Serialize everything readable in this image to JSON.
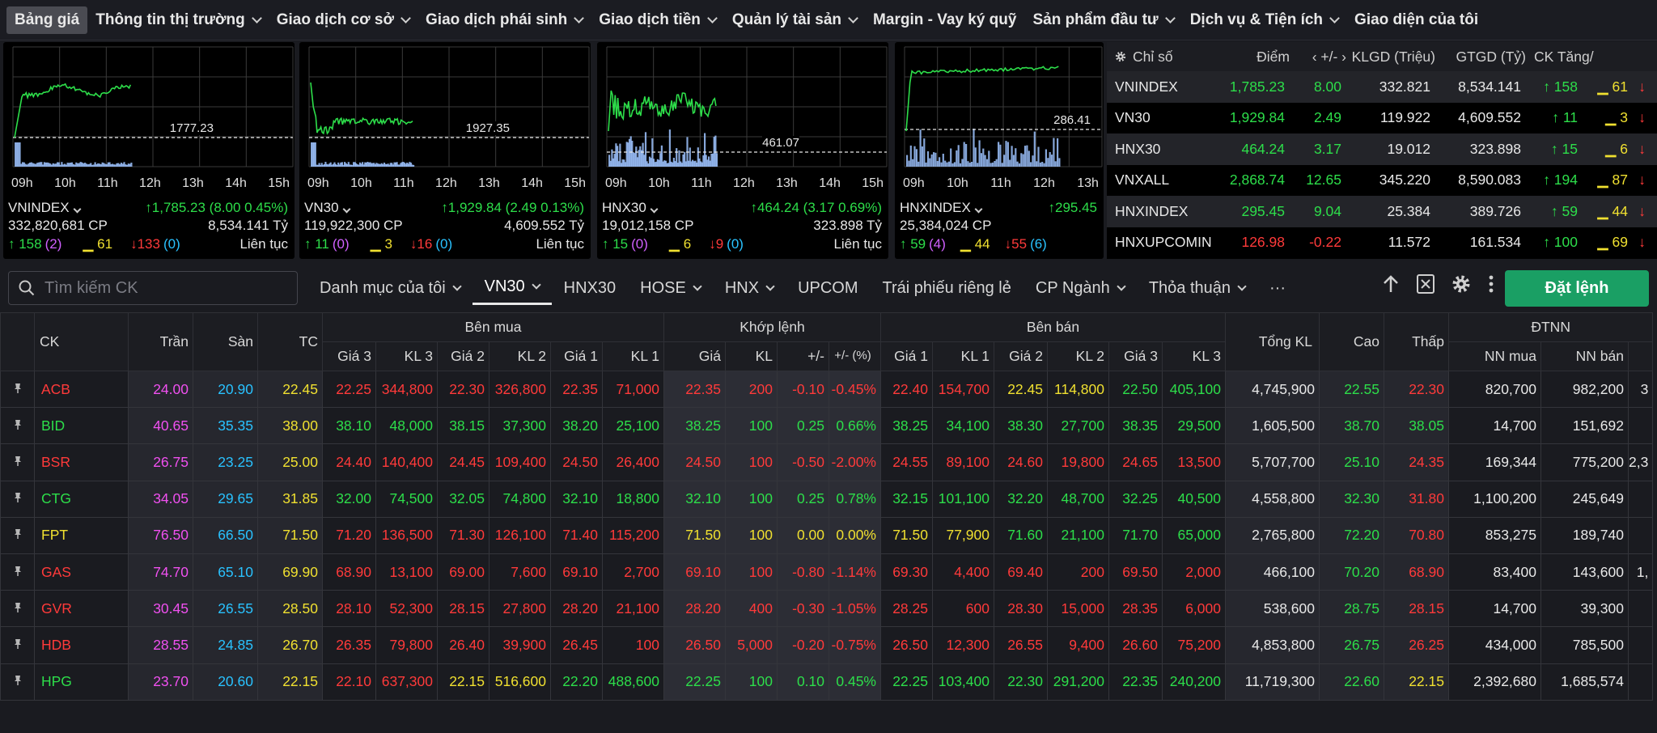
{
  "nav": [
    "Bảng giá",
    "Thông tin thị trường",
    "Giao dịch cơ sở",
    "Giao dịch phái sinh",
    "Giao dịch tiền",
    "Quản lý tài sản",
    "Margin - Vay ký quỹ",
    "Sản phẩm đầu tư",
    "Dịch vụ & Tiện ích",
    "Giao diện của tôi"
  ],
  "nav_dropdown": [
    false,
    true,
    true,
    true,
    true,
    true,
    false,
    true,
    true,
    false
  ],
  "index_cards": [
    {
      "name": "VNINDEX",
      "ref_label": "1777.23",
      "change": "↑1,785.23 (8.00 0.45%)",
      "volume": "332,820,681 CP",
      "value": "8,534.141 Tỷ",
      "up": "↑ 158",
      "up_ceil": "(2)",
      "flat": "▁ 61",
      "down": "↓133",
      "down_floor": "(0)",
      "status": "Liên tục",
      "times": [
        "09h",
        "10h",
        "11h",
        "12h",
        "13h",
        "14h",
        "15h"
      ]
    },
    {
      "name": "VN30",
      "ref_label": "1927.35",
      "change": "↑1,929.84 (2.49 0.13%)",
      "volume": "119,922,300 CP",
      "value": "4,609.552 Tỷ",
      "up": "↑ 11",
      "up_ceil": "(0)",
      "flat": "▁ 3",
      "down": "↓16",
      "down_floor": "(0)",
      "status": "Liên tục",
      "times": [
        "09h",
        "10h",
        "11h",
        "12h",
        "13h",
        "14h",
        "15h"
      ]
    },
    {
      "name": "HNX30",
      "ref_label": "461.07",
      "change": "↑464.24 (3.17 0.69%)",
      "volume": "19,012,158 CP",
      "value": "323.898 Tỷ",
      "up": "↑ 15",
      "up_ceil": "(0)",
      "flat": "▁ 6",
      "down": "↓9",
      "down_floor": "(0)",
      "status": "Liên tục",
      "times": [
        "09h",
        "10h",
        "11h",
        "12h",
        "13h",
        "14h",
        "15h"
      ]
    },
    {
      "name": "HNXINDEX",
      "ref_label": "286.41",
      "change": "↑295.45",
      "volume": "25,384,024 CP",
      "value": "",
      "up": "↑ 59",
      "up_ceil": "(4)",
      "flat": "▁ 44",
      "down": "↓55",
      "down_floor": "(6)",
      "status": "",
      "times": [
        "09h",
        "10h",
        "11h",
        "12h",
        "13h"
      ]
    }
  ],
  "index_table": {
    "headers": [
      "Chỉ số",
      "Điểm",
      "‹ +/- ›",
      "KLGD (Triệu)",
      "GTGD (Tỷ)",
      "CK Tăng/"
    ],
    "rows": [
      [
        "VNINDEX",
        "1,785.23",
        "8.00",
        "332.821",
        "8,534.141",
        "↑ 158",
        "▁ 61",
        "↓"
      ],
      [
        "VN30",
        "1,929.84",
        "2.49",
        "119.922",
        "4,609.552",
        "↑ 11",
        "▁ 3",
        "↓"
      ],
      [
        "HNX30",
        "464.24",
        "3.17",
        "19.012",
        "323.898",
        "↑ 15",
        "▁ 6",
        "↓"
      ],
      [
        "VNXALL",
        "2,868.74",
        "12.65",
        "345.220",
        "8,590.083",
        "↑ 194",
        "▁ 87",
        "↓"
      ],
      [
        "HNXINDEX",
        "295.45",
        "9.04",
        "25.384",
        "389.726",
        "↑ 59",
        "▁ 44",
        "↓"
      ],
      [
        "HNXUPCOMINDEX",
        "126.98",
        "-0.22",
        "11.572",
        "161.534",
        "↑ 100",
        "▁ 69",
        "↓"
      ]
    ],
    "row_colors": [
      "up",
      "up",
      "up",
      "up",
      "up",
      "dn"
    ]
  },
  "search": {
    "placeholder": "Tìm kiếm CK"
  },
  "tabs": [
    {
      "label": "Danh mục của tôi",
      "dd": true
    },
    {
      "label": "VN30",
      "dd": true,
      "active": true
    },
    {
      "label": "HNX30",
      "dd": false
    },
    {
      "label": "HOSE",
      "dd": true
    },
    {
      "label": "HNX",
      "dd": true
    },
    {
      "label": "UPCOM",
      "dd": false
    },
    {
      "label": "Trái phiếu riêng lẻ",
      "dd": false
    },
    {
      "label": "CP Ngành",
      "dd": true
    },
    {
      "label": "Thỏa thuận",
      "dd": true
    },
    {
      "label": "···",
      "dd": false
    }
  ],
  "order_button": "Đặt lệnh",
  "board": {
    "group_headers": {
      "buy": "Bên mua",
      "match": "Khớp lệnh",
      "sell": "Bên bán",
      "foreign": "ĐTNN"
    },
    "headers": [
      "CK",
      "Trần",
      "Sàn",
      "TC",
      "Giá 3",
      "KL 3",
      "Giá 2",
      "KL 2",
      "Giá 1",
      "KL 1",
      "Giá",
      "KL",
      "+/-",
      "+/- (%)",
      "Giá 1",
      "KL 1",
      "Giá 2",
      "KL 2",
      "Giá 3",
      "KL 3",
      "Tổng KL",
      "Cao",
      "Thấp",
      "NN mua",
      "NN bán"
    ],
    "rows": [
      {
        "s": "ACB",
        "c": [
          "24.00",
          "20.90",
          "22.45",
          "22.25",
          "344,800",
          "22.30",
          "326,800",
          "22.35",
          "71,000",
          "22.35",
          "200",
          "-0.10",
          "-0.45%",
          "22.40",
          "154,700",
          "22.45",
          "114,800",
          "22.50",
          "405,100",
          "4,745,900",
          "22.55",
          "22.30",
          "820,700",
          "982,200",
          "3"
        ],
        "k": "dn",
        "bk": [
          "dn",
          "dn",
          "dn"
        ],
        "sk": [
          "dn",
          "ref",
          "up"
        ],
        "hk": "up",
        "lk": "dn"
      },
      {
        "s": "BID",
        "c": [
          "40.65",
          "35.35",
          "38.00",
          "38.10",
          "48,000",
          "38.15",
          "37,300",
          "38.20",
          "25,100",
          "38.25",
          "100",
          "0.25",
          "0.66%",
          "38.25",
          "34,100",
          "38.30",
          "27,700",
          "38.35",
          "29,500",
          "1,605,500",
          "38.70",
          "38.05",
          "14,700",
          "151,692",
          ""
        ],
        "k": "up",
        "bk": [
          "up",
          "up",
          "up"
        ],
        "sk": [
          "up",
          "up",
          "up"
        ],
        "hk": "up",
        "lk": "up"
      },
      {
        "s": "BSR",
        "c": [
          "26.75",
          "23.25",
          "25.00",
          "24.40",
          "140,400",
          "24.45",
          "109,400",
          "24.50",
          "26,400",
          "24.50",
          "100",
          "-0.50",
          "-2.00%",
          "24.55",
          "89,100",
          "24.60",
          "19,800",
          "24.65",
          "13,500",
          "5,707,700",
          "25.10",
          "24.35",
          "169,344",
          "775,200",
          "2,3"
        ],
        "k": "dn",
        "bk": [
          "dn",
          "dn",
          "dn"
        ],
        "sk": [
          "dn",
          "dn",
          "dn"
        ],
        "hk": "up",
        "lk": "dn"
      },
      {
        "s": "CTG",
        "c": [
          "34.05",
          "29.65",
          "31.85",
          "32.00",
          "74,500",
          "32.05",
          "74,800",
          "32.10",
          "18,800",
          "32.10",
          "100",
          "0.25",
          "0.78%",
          "32.15",
          "101,100",
          "32.20",
          "48,700",
          "32.25",
          "40,500",
          "4,558,800",
          "32.30",
          "31.80",
          "1,100,200",
          "245,649",
          ""
        ],
        "k": "up",
        "bk": [
          "up",
          "up",
          "up"
        ],
        "sk": [
          "up",
          "up",
          "up"
        ],
        "hk": "up",
        "lk": "dn"
      },
      {
        "s": "FPT",
        "c": [
          "76.50",
          "66.50",
          "71.50",
          "71.20",
          "136,500",
          "71.30",
          "126,100",
          "71.40",
          "115,200",
          "71.50",
          "100",
          "0.00",
          "0.00%",
          "71.50",
          "77,900",
          "71.60",
          "21,100",
          "71.70",
          "65,000",
          "2,765,800",
          "72.20",
          "70.80",
          "853,275",
          "189,740",
          ""
        ],
        "k": "ref",
        "bk": [
          "dn",
          "dn",
          "dn"
        ],
        "sk": [
          "ref",
          "up",
          "up"
        ],
        "hk": "up",
        "lk": "dn"
      },
      {
        "s": "GAS",
        "c": [
          "74.70",
          "65.10",
          "69.90",
          "68.90",
          "13,100",
          "69.00",
          "7,600",
          "69.10",
          "2,700",
          "69.10",
          "100",
          "-0.80",
          "-1.14%",
          "69.30",
          "4,400",
          "69.40",
          "200",
          "69.50",
          "2,000",
          "466,100",
          "70.20",
          "68.90",
          "83,400",
          "143,600",
          "1,"
        ],
        "k": "dn",
        "bk": [
          "dn",
          "dn",
          "dn"
        ],
        "sk": [
          "dn",
          "dn",
          "dn"
        ],
        "hk": "up",
        "lk": "dn"
      },
      {
        "s": "GVR",
        "c": [
          "30.45",
          "26.55",
          "28.50",
          "28.10",
          "52,300",
          "28.15",
          "27,800",
          "28.20",
          "21,100",
          "28.20",
          "400",
          "-0.30",
          "-1.05%",
          "28.25",
          "600",
          "28.30",
          "15,000",
          "28.35",
          "6,000",
          "538,600",
          "28.75",
          "28.15",
          "14,700",
          "39,300",
          ""
        ],
        "k": "dn",
        "bk": [
          "dn",
          "dn",
          "dn"
        ],
        "sk": [
          "dn",
          "dn",
          "dn"
        ],
        "hk": "up",
        "lk": "dn"
      },
      {
        "s": "HDB",
        "c": [
          "28.55",
          "24.85",
          "26.70",
          "26.35",
          "79,800",
          "26.40",
          "39,900",
          "26.45",
          "100",
          "26.50",
          "5,000",
          "-0.20",
          "-0.75%",
          "26.50",
          "12,300",
          "26.55",
          "9,400",
          "26.60",
          "75,200",
          "4,853,800",
          "26.75",
          "26.25",
          "434,000",
          "785,500",
          ""
        ],
        "k": "dn",
        "bk": [
          "dn",
          "dn",
          "dn"
        ],
        "sk": [
          "dn",
          "dn",
          "dn"
        ],
        "hk": "up",
        "lk": "dn"
      },
      {
        "s": "HPG",
        "c": [
          "23.70",
          "20.60",
          "22.15",
          "22.10",
          "637,300",
          "22.15",
          "516,600",
          "22.20",
          "488,600",
          "22.25",
          "100",
          "0.10",
          "0.45%",
          "22.25",
          "103,400",
          "22.30",
          "291,200",
          "22.35",
          "240,200",
          "11,719,300",
          "22.60",
          "22.15",
          "2,392,680",
          "1,685,574",
          ""
        ],
        "k": "up",
        "bk": [
          "dn",
          "ref",
          "up"
        ],
        "sk": [
          "up",
          "up",
          "up"
        ],
        "hk": "up",
        "lk": "ref"
      }
    ]
  },
  "colors": {
    "up": "#2dde4a",
    "down": "#ff3a3a",
    "ref": "#f0e030",
    "ceil": "#f050f0",
    "floor": "#29c2ff",
    "accent": "#1a9f64"
  }
}
